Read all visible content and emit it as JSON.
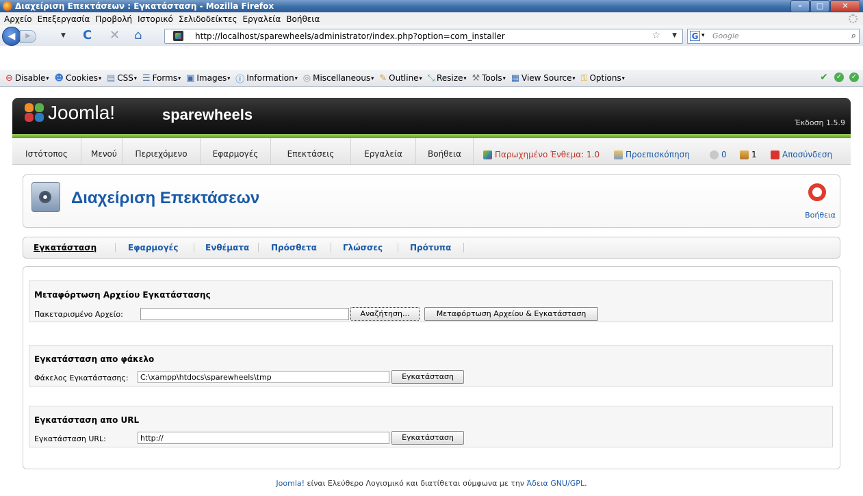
{
  "window": {
    "title": "Διαχείριση Επεκτάσεων : Εγκατάσταση - Mozilla Firefox"
  },
  "menubar": [
    "Αρχείο",
    "Επεξεργασία",
    "Προβολή",
    "Ιστορικό",
    "Σελιδοδείκτες",
    "Εργαλεία",
    "Βοήθεια"
  ],
  "nav": {
    "url": "http://localhost/sparewheels/administrator/index.php?option=com_installer",
    "search_placeholder": "Google"
  },
  "devbar": [
    "Disable",
    "Cookies",
    "CSS",
    "Forms",
    "Images",
    "Information",
    "Miscellaneous",
    "Outline",
    "Resize",
    "Tools",
    "View Source",
    "Options"
  ],
  "joomla": {
    "brand": "Joomla!",
    "site": "sparewheels",
    "version": "Έκδοση 1.5.9",
    "menu": [
      "Ιστότοπος",
      "Μενού",
      "Περιεχόμενο",
      "Εφαρμογές",
      "Επεκτάσεις",
      "Εργαλεία",
      "Βοήθεια"
    ],
    "status": {
      "legacy": "Παρωχημένο Ένθεμα: 1.0",
      "preview": "Προεπισκόπηση",
      "messages": "0",
      "users": "1",
      "logout": "Αποσύνδεση"
    },
    "page_title": "Διαχείριση Επεκτάσεων",
    "help": "Βοήθεια",
    "subnav": [
      "Εγκατάσταση",
      "Εφαρμογές",
      "Ενθέματα",
      "Πρόσθετα",
      "Γλώσσες",
      "Πρότυπα"
    ],
    "upload": {
      "legend": "Μεταφόρτωση Αρχείου Εγκατάστασης",
      "label": "Πακεταρισμένο Αρχείο:",
      "value": "",
      "browse": "Αναζήτηση...",
      "button": "Μεταφόρτωση Αρχείου & Εγκατάσταση"
    },
    "folder": {
      "legend": "Εγκατάσταση απο φάκελο",
      "label": "Φάκελος Εγκατάστασης:",
      "value": "C:\\xampp\\htdocs\\sparewheels\\tmp",
      "button": "Εγκατάσταση"
    },
    "url": {
      "legend": "Εγκατάσταση απο URL",
      "label": "Εγκατάσταση URL:",
      "value": "http://",
      "button": "Εγκατάσταση"
    },
    "footer": {
      "brand": "Joomla!",
      "text": " είναι Ελεύθερο Λογισμικό και διατίθεται σύμφωνα με την ",
      "license": "Άδεια GNU/GPL",
      "end": "."
    }
  }
}
